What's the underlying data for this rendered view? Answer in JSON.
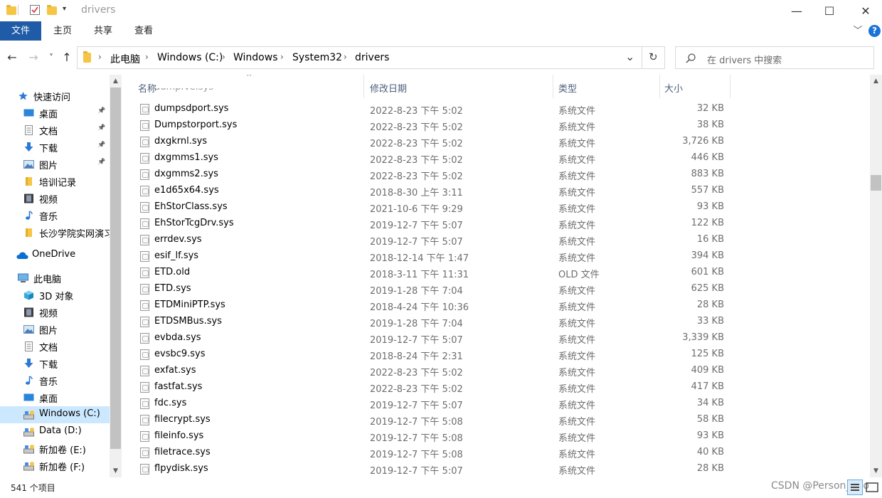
{
  "window": {
    "title": "drivers",
    "minimize": "—",
    "maximize": "☐",
    "close": "✕"
  },
  "ribbon": {
    "tabs": [
      "文件",
      "主页",
      "共享",
      "查看"
    ],
    "expand": "﹀",
    "help": "?"
  },
  "nav": {
    "back": "←",
    "forward": "→",
    "recent": "˅",
    "up": "↑",
    "breadcrumbs": [
      "此电脑",
      "Windows (C:)",
      "Windows",
      "System32",
      "drivers"
    ],
    "dropdown": "⌄",
    "refresh": "↻",
    "search_placeholder": "在 drivers 中搜索"
  },
  "sidebar": {
    "items": [
      {
        "label": "快速访问",
        "icon": "star-icon",
        "pinned": false
      },
      {
        "label": "桌面",
        "icon": "desktop-icon",
        "pinned": true
      },
      {
        "label": "文档",
        "icon": "documents-icon",
        "pinned": true
      },
      {
        "label": "下载",
        "icon": "download-icon",
        "pinned": true
      },
      {
        "label": "图片",
        "icon": "pictures-icon",
        "pinned": true
      },
      {
        "label": "培训记录",
        "icon": "folder-icon",
        "pinned": false
      },
      {
        "label": "视频",
        "icon": "video-icon",
        "pinned": false
      },
      {
        "label": "音乐",
        "icon": "music-icon",
        "pinned": false
      },
      {
        "label": "长沙学院实网演习",
        "icon": "folder-icon",
        "pinned": false
      },
      {
        "label": "OneDrive",
        "icon": "cloud-icon",
        "pinned": false
      },
      {
        "label": "此电脑",
        "icon": "computer-icon",
        "pinned": false
      },
      {
        "label": "3D 对象",
        "icon": "cube-icon",
        "pinned": false
      },
      {
        "label": "视频",
        "icon": "video-icon",
        "pinned": false
      },
      {
        "label": "图片",
        "icon": "pictures-icon",
        "pinned": false
      },
      {
        "label": "文档",
        "icon": "documents-icon",
        "pinned": false
      },
      {
        "label": "下载",
        "icon": "download-icon",
        "pinned": false
      },
      {
        "label": "音乐",
        "icon": "music-icon",
        "pinned": false
      },
      {
        "label": "桌面",
        "icon": "desktop-icon",
        "pinned": false
      },
      {
        "label": "Windows (C:)",
        "icon": "drive-icon",
        "pinned": false,
        "selected": true
      },
      {
        "label": "Data (D:)",
        "icon": "drive-icon",
        "pinned": false
      },
      {
        "label": "新加卷 (E:)",
        "icon": "drive-icon",
        "pinned": false
      },
      {
        "label": "新加卷 (F:)",
        "icon": "drive-icon",
        "pinned": false
      }
    ]
  },
  "columns": {
    "name": "名称",
    "date": "修改日期",
    "type": "类型",
    "size": "大小"
  },
  "files": [
    {
      "name": "dumpsdport.sys",
      "date": "2022-8-23 下午 5:02",
      "type": "系统文件",
      "size": "32 KB"
    },
    {
      "name": "Dumpstorport.sys",
      "date": "2022-8-23 下午 5:02",
      "type": "系统文件",
      "size": "38 KB"
    },
    {
      "name": "dxgkrnl.sys",
      "date": "2022-8-23 下午 5:02",
      "type": "系统文件",
      "size": "3,726 KB"
    },
    {
      "name": "dxgmms1.sys",
      "date": "2022-8-23 下午 5:02",
      "type": "系统文件",
      "size": "446 KB"
    },
    {
      "name": "dxgmms2.sys",
      "date": "2022-8-23 下午 5:02",
      "type": "系统文件",
      "size": "883 KB"
    },
    {
      "name": "e1d65x64.sys",
      "date": "2018-8-30 上午 3:11",
      "type": "系统文件",
      "size": "557 KB"
    },
    {
      "name": "EhStorClass.sys",
      "date": "2021-10-6 下午 9:29",
      "type": "系统文件",
      "size": "93 KB"
    },
    {
      "name": "EhStorTcgDrv.sys",
      "date": "2019-12-7 下午 5:07",
      "type": "系统文件",
      "size": "122 KB"
    },
    {
      "name": "errdev.sys",
      "date": "2019-12-7 下午 5:07",
      "type": "系统文件",
      "size": "16 KB"
    },
    {
      "name": "esif_lf.sys",
      "date": "2018-12-14 下午 1:47",
      "type": "系统文件",
      "size": "394 KB"
    },
    {
      "name": "ETD.old",
      "date": "2018-3-11 下午 11:31",
      "type": "OLD 文件",
      "size": "601 KB"
    },
    {
      "name": "ETD.sys",
      "date": "2019-1-28 下午 7:04",
      "type": "系统文件",
      "size": "625 KB"
    },
    {
      "name": "ETDMiniPTP.sys",
      "date": "2018-4-24 下午 10:36",
      "type": "系统文件",
      "size": "28 KB"
    },
    {
      "name": "ETDSMBus.sys",
      "date": "2019-1-28 下午 7:04",
      "type": "系统文件",
      "size": "33 KB"
    },
    {
      "name": "evbda.sys",
      "date": "2019-12-7 下午 5:07",
      "type": "系统文件",
      "size": "3,339 KB"
    },
    {
      "name": "evsbc9.sys",
      "date": "2018-8-24 下午 2:31",
      "type": "系统文件",
      "size": "125 KB"
    },
    {
      "name": "exfat.sys",
      "date": "2022-8-23 下午 5:02",
      "type": "系统文件",
      "size": "409 KB"
    },
    {
      "name": "fastfat.sys",
      "date": "2022-8-23 下午 5:02",
      "type": "系统文件",
      "size": "417 KB"
    },
    {
      "name": "fdc.sys",
      "date": "2019-12-7 下午 5:07",
      "type": "系统文件",
      "size": "34 KB"
    },
    {
      "name": "filecrypt.sys",
      "date": "2019-12-7 下午 5:08",
      "type": "系统文件",
      "size": "58 KB"
    },
    {
      "name": "fileinfo.sys",
      "date": "2019-12-7 下午 5:08",
      "type": "系统文件",
      "size": "93 KB"
    },
    {
      "name": "filetrace.sys",
      "date": "2019-12-7 下午 5:08",
      "type": "系统文件",
      "size": "40 KB"
    },
    {
      "name": "flpydisk.sys",
      "date": "2019-12-7 下午 5:07",
      "type": "系统文件",
      "size": "28 KB"
    }
  ],
  "status": {
    "count": "541 个项目",
    "watermark": "CSDN @Person_two"
  },
  "colors": {
    "file_tab": "#1f5ba6",
    "selected": "#cce8ff",
    "help": "#1a73d8"
  }
}
